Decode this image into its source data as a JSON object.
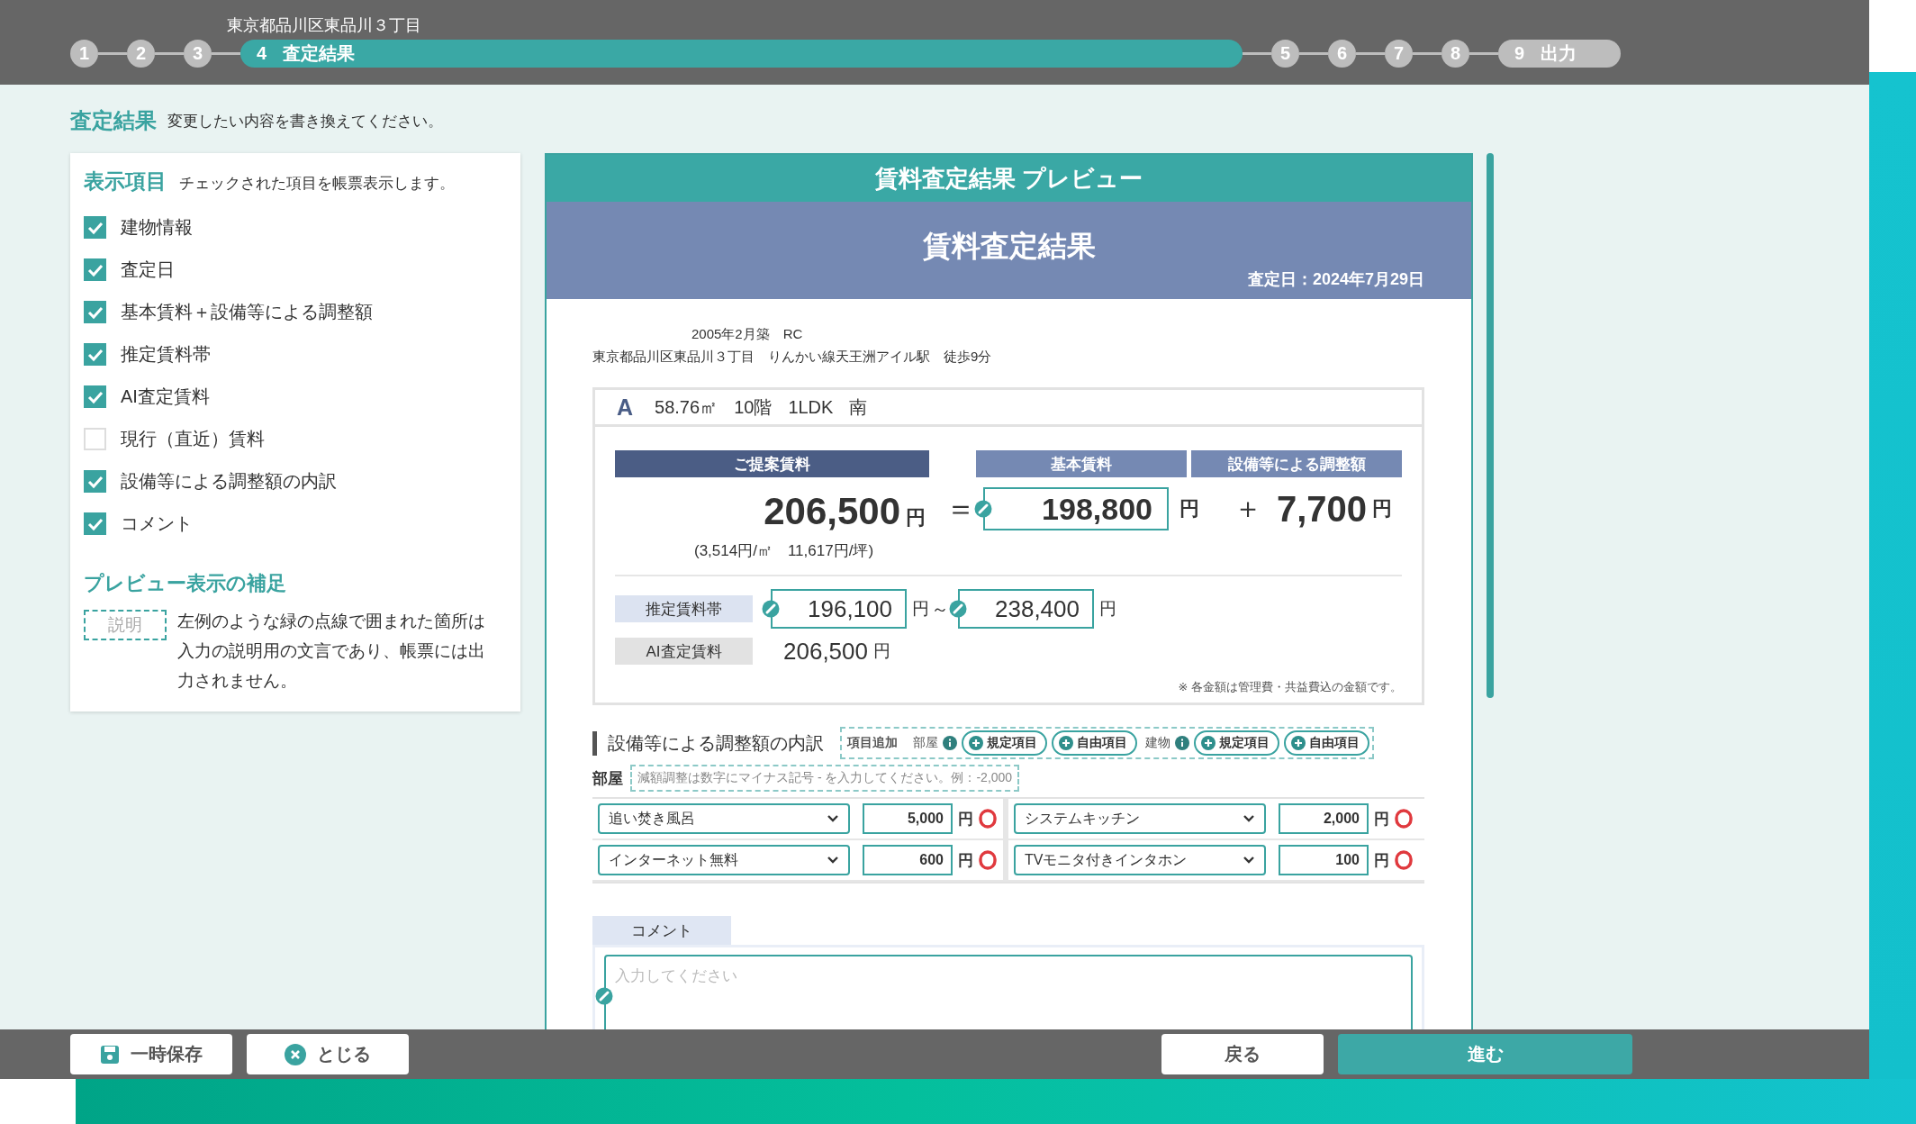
{
  "address_heading": "東京都品川区東品川３丁目",
  "steps": [
    {
      "label": "1",
      "selected": false
    },
    {
      "label": "2",
      "selected": false
    },
    {
      "label": "3",
      "selected": false
    },
    {
      "label": "4",
      "title": "査定結果",
      "selected": true
    },
    {
      "label": "5",
      "selected": false
    },
    {
      "label": "6",
      "selected": false
    },
    {
      "label": "7",
      "selected": false
    },
    {
      "label": "8",
      "selected": false
    },
    {
      "label": "9",
      "title": "出力",
      "selected": false
    }
  ],
  "page": {
    "title": "査定結果",
    "hint": "変更したい内容を書き換えてください。"
  },
  "display_items": {
    "title": "表示項目",
    "hint": "チェックされた項目を帳票表示します。",
    "items": [
      {
        "label": "建物情報",
        "checked": true
      },
      {
        "label": "査定日",
        "checked": true
      },
      {
        "label": "基本賃料＋設備等による調整額",
        "checked": true
      },
      {
        "label": "推定賃料帯",
        "checked": true
      },
      {
        "label": "AI査定賃料",
        "checked": true
      },
      {
        "label": "現行（直近）賃料",
        "checked": false
      },
      {
        "label": "設備等による調整額の内訳",
        "checked": true
      },
      {
        "label": "コメント",
        "checked": true
      }
    ]
  },
  "preview_note": {
    "title": "プレビュー表示の補足",
    "sample": "説明",
    "text": "左例のような緑の点線で囲まれた箇所は入力の説明用の文言であり、帳票には出力されません。"
  },
  "preview": {
    "title": "賃料査定結果 プレビュー",
    "report_title": "賃料査定結果",
    "date": "査定日：2024年7月29日",
    "building": "2005年2月築　RC",
    "location": "東京都品川区東品川３丁目　りんかい線天王洲アイル駅　徒歩9分",
    "unit_name": "A",
    "unit_specs": [
      "58.76㎡",
      "10階",
      "1LDK",
      "南"
    ],
    "proposed": {
      "label": "ご提案賃料",
      "value": "206,500",
      "unit": "円",
      "per_area": "(3,514円/㎡　11,617円/坪)"
    },
    "equals": "＝",
    "base": {
      "label": "基本賃料",
      "value": "198,800",
      "unit": "円"
    },
    "plus": "＋",
    "adjustment": {
      "label": "設備等による調整額",
      "value": "7,700",
      "unit": "円"
    },
    "range": {
      "label": "推定賃料帯",
      "low": "196,100",
      "low_unit": "円",
      "tilde": "～",
      "high": "238,400",
      "high_unit": "円"
    },
    "ai": {
      "label": "AI査定賃料",
      "value": "206,500",
      "unit": "円"
    },
    "footnote": "※ 各金額は管理費・共益費込の金額です。",
    "breakdown": {
      "title": "設備等による調整額の内訳",
      "add_label": "項目追加",
      "add_groups": [
        {
          "name": "部屋",
          "buttons": [
            "規定項目",
            "自由項目"
          ]
        },
        {
          "name": "建物",
          "buttons": [
            "規定項目",
            "自由項目"
          ]
        }
      ],
      "room_label": "部屋",
      "hint": "減額調整は数字にマイナス記号 - を入力してください。例：-2,000",
      "items": [
        {
          "item": "追い焚き風呂",
          "amount": "5,000",
          "unit": "円"
        },
        {
          "item": "システムキッチン",
          "amount": "2,000",
          "unit": "円"
        },
        {
          "item": "インターネット無料",
          "amount": "600",
          "unit": "円"
        },
        {
          "item": "TVモニタ付きインタホン",
          "amount": "100",
          "unit": "円"
        }
      ]
    },
    "comment": {
      "tab": "コメント",
      "placeholder": "入力してください"
    }
  },
  "buttons": {
    "save": "一時保存",
    "close": "とじる",
    "back": "戻る",
    "next": "進む"
  }
}
